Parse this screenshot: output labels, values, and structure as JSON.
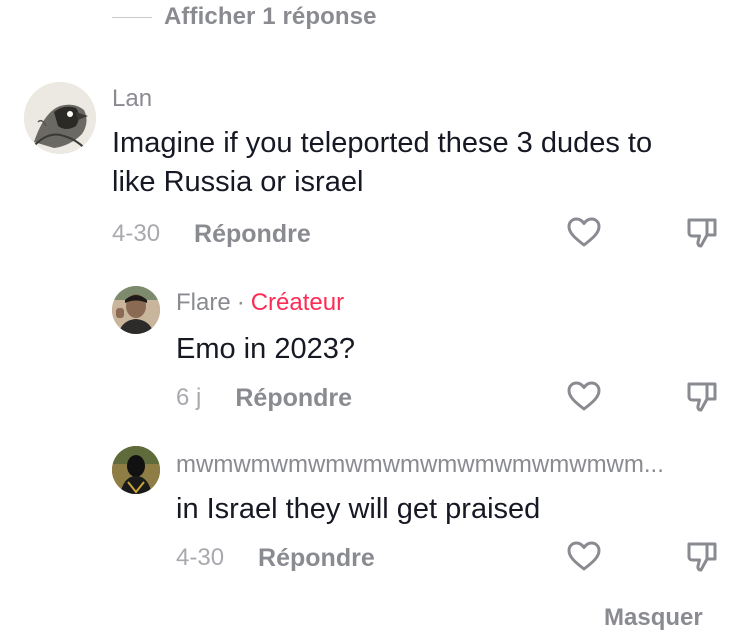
{
  "view_replies": {
    "label": "Afficher 1 réponse"
  },
  "comments": [
    {
      "username": "Lan",
      "text_lines": [
        "Imagine if you teleported these 3 dudes to",
        "like Russia or israel"
      ],
      "date": "4-30",
      "reply_label": "Répondre",
      "avatar_icon": "bird-sketch-avatar"
    },
    {
      "username": "Flare",
      "separator": "·",
      "badge": "Créateur",
      "text": "Emo in 2023?",
      "date": "6 j",
      "reply_label": "Répondre",
      "avatar_icon": "person-photo-avatar"
    },
    {
      "username": "mwmwmwmwmwmwmwmwmwmwmwmwm...",
      "text": "in Israel they will get praised",
      "date": "4-30",
      "reply_label": "Répondre",
      "avatar_icon": "masked-person-avatar"
    }
  ],
  "partial_footer": "Masquer",
  "colors": {
    "creator_badge": "#fe2c55",
    "secondary_text": "#8a8b91",
    "primary_text": "#161823"
  },
  "icons": {
    "like": "heart-outline-icon",
    "dislike": "thumbs-down-outline-icon"
  }
}
